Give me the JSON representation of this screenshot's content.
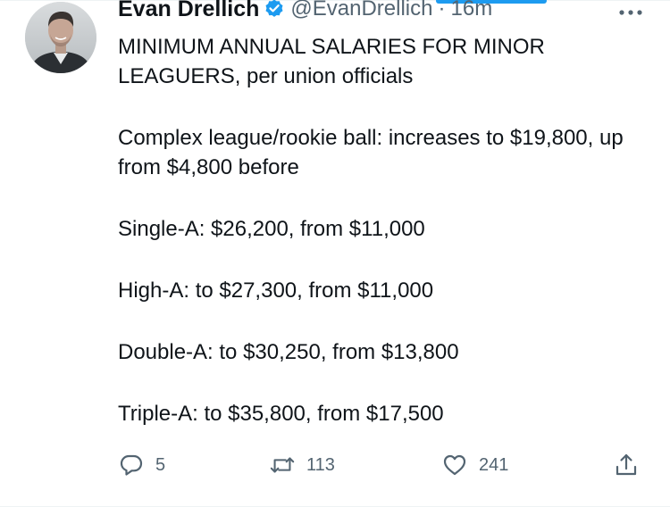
{
  "author": {
    "display_name": "Evan Drellich",
    "handle": "@EvanDrellich",
    "separator": "·",
    "timestamp": "16m",
    "verified": true,
    "verified_color": "#1d9bf0"
  },
  "tweet": {
    "paragraphs": [
      "MINIMUM ANNUAL SALARIES FOR MINOR LEAGUERS, per union officials",
      "Complex league/rookie ball: increases to $19,800, up from $4,800 before",
      "Single-A: $26,200, from $11,000",
      "High-A: to $27,300, from $11,000",
      "Double-A: to $30,250, from $13,800",
      "Triple-A: to $35,800, from $17,500"
    ]
  },
  "actions": {
    "reply": {
      "icon": "reply-icon",
      "count": "5"
    },
    "retweet": {
      "icon": "retweet-icon",
      "count": "113"
    },
    "like": {
      "icon": "heart-icon",
      "count": "241"
    },
    "share": {
      "icon": "share-icon"
    }
  },
  "more_menu": {
    "icon": "more-horizontal-icon"
  },
  "colors": {
    "text_primary": "#0f1419",
    "text_secondary": "#536471",
    "accent": "#1d9bf0"
  }
}
